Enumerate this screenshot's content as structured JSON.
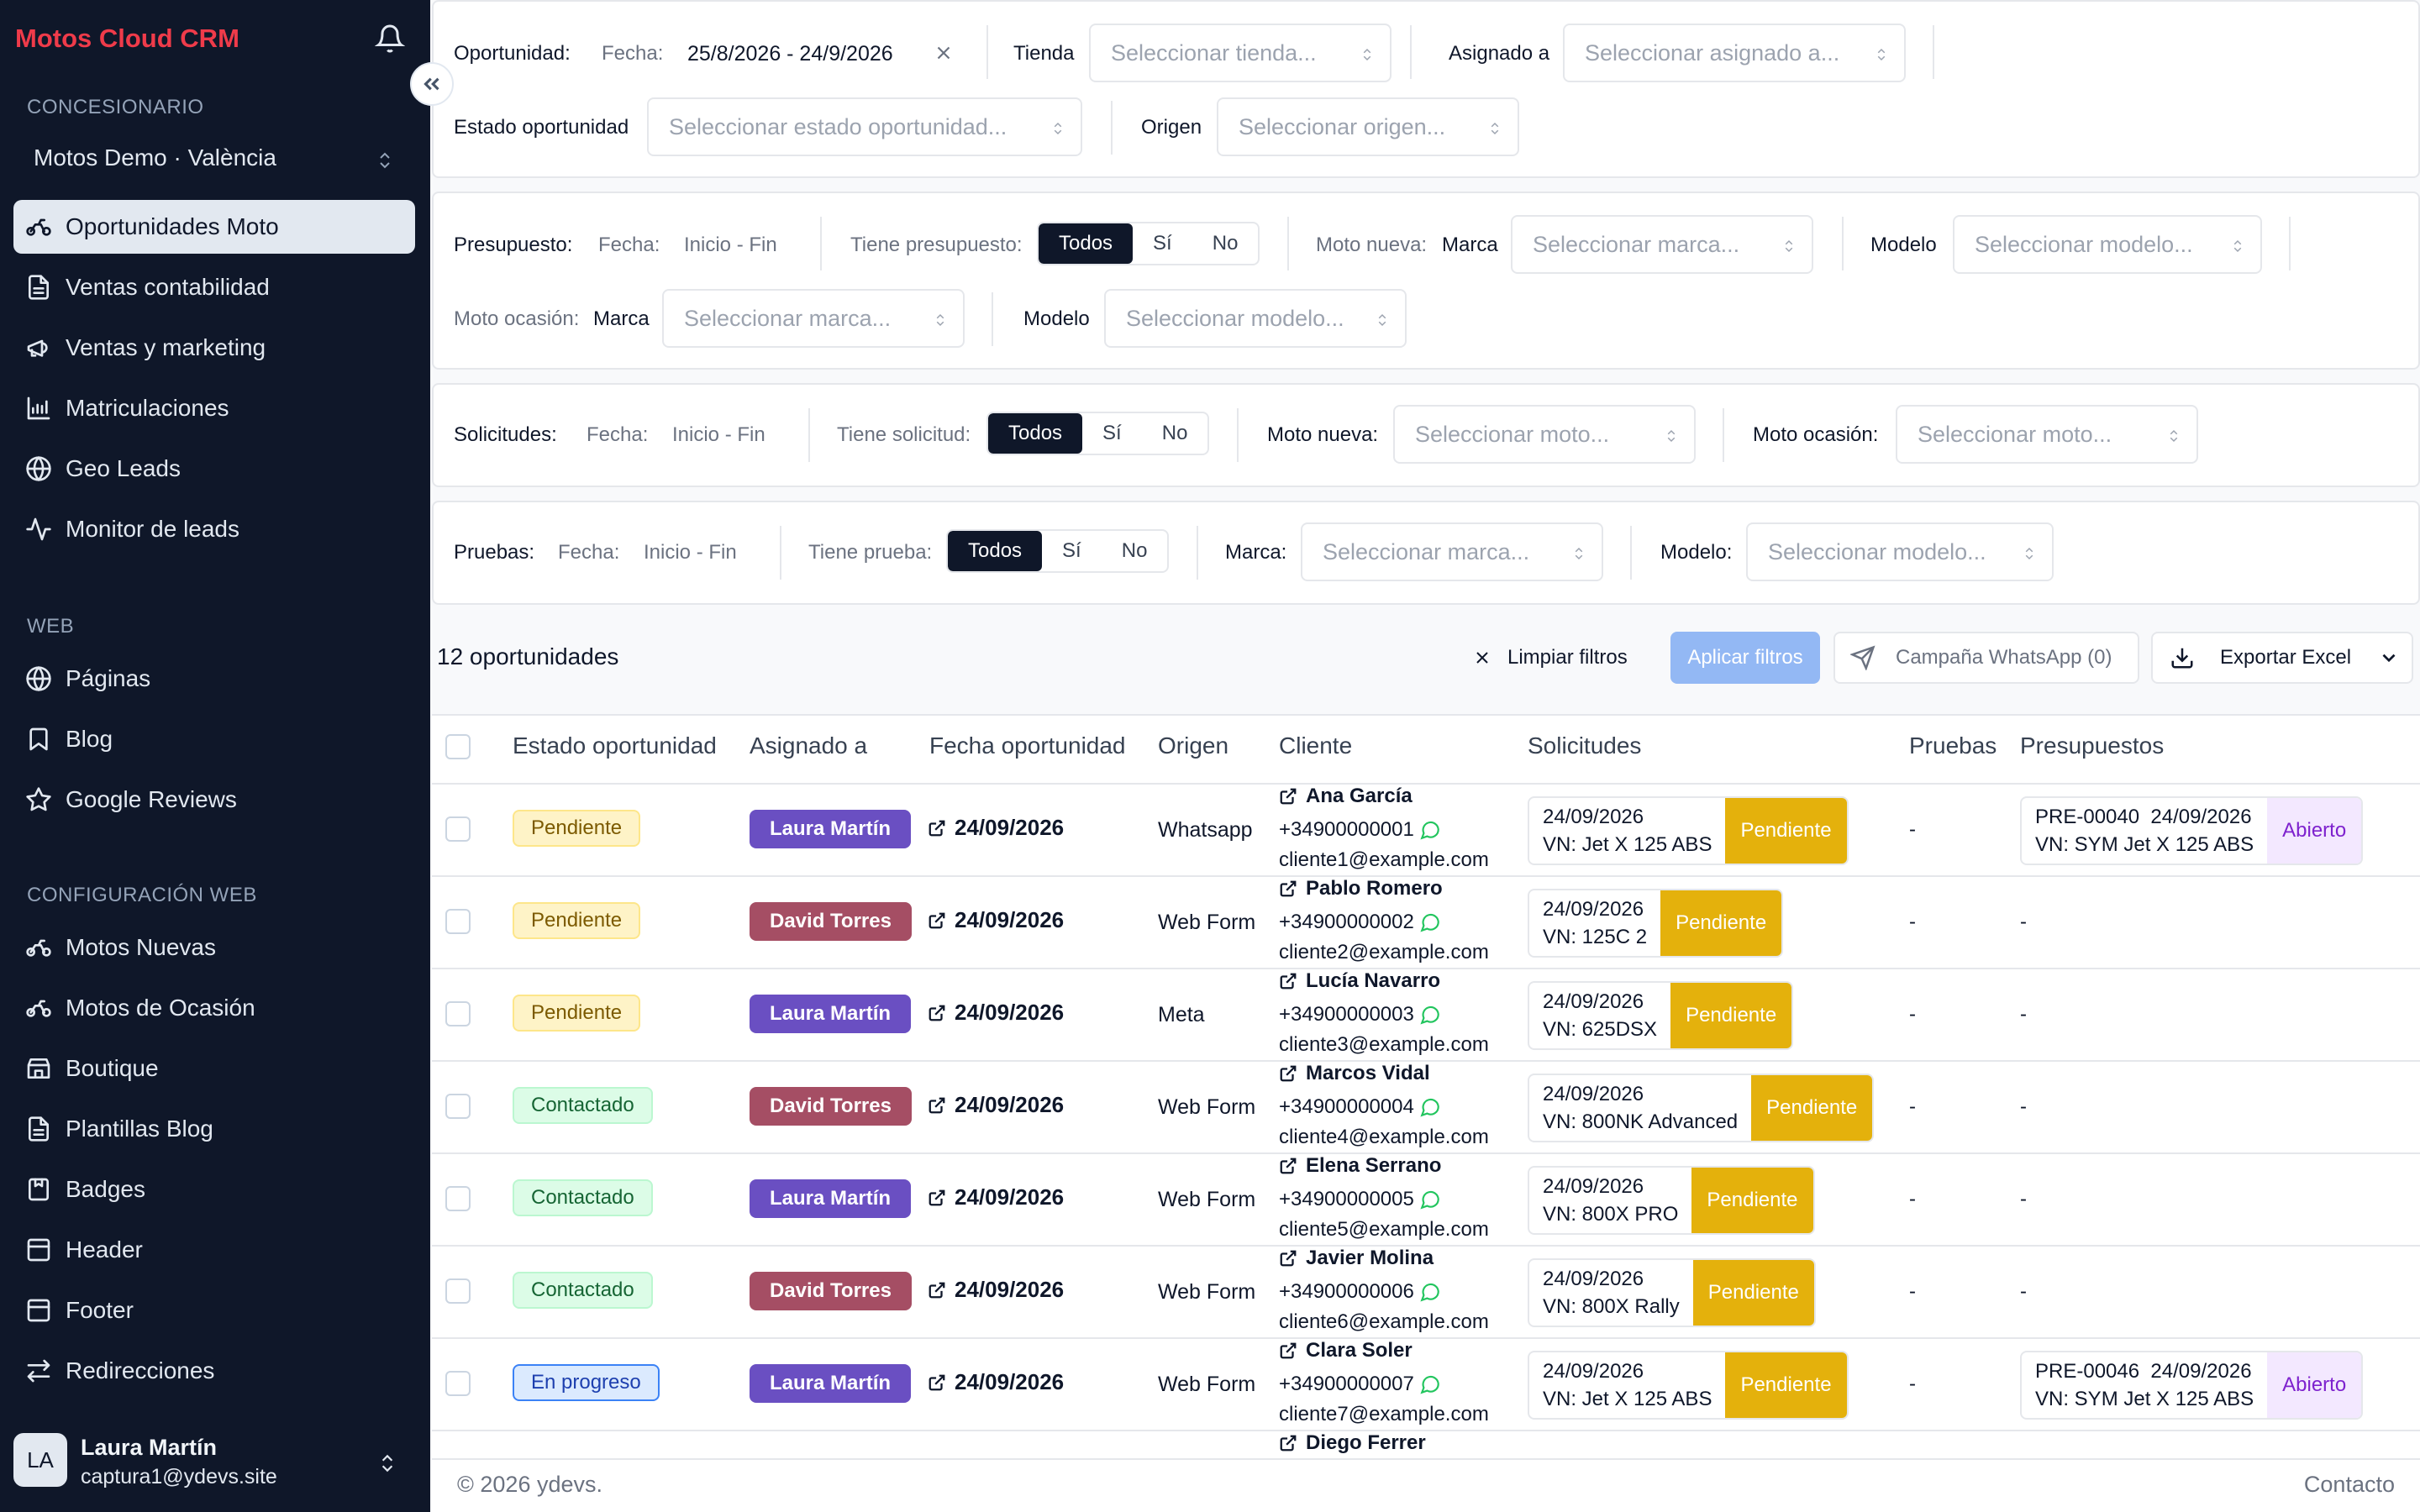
{
  "app": {
    "title": "Motos Cloud CRM"
  },
  "sidebar": {
    "section_dealer": "CONCESIONARIO",
    "dealer": "Motos Demo · València",
    "items_main": [
      {
        "label": "Oportunidades Moto",
        "icon": "motorbike-icon"
      },
      {
        "label": "Ventas contabilidad",
        "icon": "document-icon"
      },
      {
        "label": "Ventas y marketing",
        "icon": "megaphone-icon"
      },
      {
        "label": "Matriculaciones",
        "icon": "chart-icon"
      },
      {
        "label": "Geo Leads",
        "icon": "globe-icon"
      },
      {
        "label": "Monitor de leads",
        "icon": "activity-icon"
      }
    ],
    "section_web": "WEB",
    "items_web": [
      {
        "label": "Páginas",
        "icon": "globe-icon"
      },
      {
        "label": "Blog",
        "icon": "bookmark-icon"
      },
      {
        "label": "Google Reviews",
        "icon": "star-icon"
      }
    ],
    "section_config": "CONFIGURACIÓN WEB",
    "items_config": [
      {
        "label": "Motos Nuevas",
        "icon": "motorbike-icon"
      },
      {
        "label": "Motos de Ocasión",
        "icon": "motorbike-icon"
      },
      {
        "label": "Boutique",
        "icon": "store-icon"
      },
      {
        "label": "Plantillas Blog",
        "icon": "document-icon"
      },
      {
        "label": "Badges",
        "icon": "badge-icon"
      },
      {
        "label": "Header",
        "icon": "layout-icon"
      },
      {
        "label": "Footer",
        "icon": "layout-icon"
      },
      {
        "label": "Redirecciones",
        "icon": "arrows-icon"
      }
    ],
    "user": {
      "initials": "LA",
      "name": "Laura Martín",
      "email": "captura1@ydevs.site"
    }
  },
  "filters": {
    "opp": {
      "label": "Oportunidad:",
      "date_label": "Fecha:",
      "date_value": "25/8/2026 - 24/9/2026",
      "store_label": "Tienda",
      "store_ph": "Seleccionar tienda...",
      "assigned_label": "Asignado a",
      "assigned_ph": "Seleccionar asignado a...",
      "state_label": "Estado oportunidad",
      "state_ph": "Seleccionar estado oportunidad...",
      "origin_label": "Origen",
      "origin_ph": "Seleccionar origen..."
    },
    "budget": {
      "label": "Presupuesto:",
      "date_label": "Fecha:",
      "date_value": "Inicio - Fin",
      "has_label": "Tiene presupuesto:",
      "seg": [
        "Todos",
        "Sí",
        "No"
      ],
      "new_label": "Moto nueva:",
      "brand_label": "Marca",
      "brand_ph": "Seleccionar marca...",
      "model_label": "Modelo",
      "model_ph": "Seleccionar modelo...",
      "used_label": "Moto ocasión:",
      "brand2_label": "Marca",
      "brand2_ph": "Seleccionar marca...",
      "model2_label": "Modelo",
      "model2_ph": "Seleccionar modelo..."
    },
    "req": {
      "label": "Solicitudes:",
      "date_label": "Fecha:",
      "date_value": "Inicio - Fin",
      "has_label": "Tiene solicitud:",
      "seg": [
        "Todos",
        "Sí",
        "No"
      ],
      "new_label": "Moto nueva:",
      "new_ph": "Seleccionar moto...",
      "used_label": "Moto ocasión:",
      "used_ph": "Seleccionar moto..."
    },
    "test": {
      "label": "Pruebas:",
      "date_label": "Fecha:",
      "date_value": "Inicio - Fin",
      "has_label": "Tiene prueba:",
      "seg": [
        "Todos",
        "Sí",
        "No"
      ],
      "brand_label": "Marca:",
      "brand_ph": "Seleccionar marca...",
      "model_label": "Modelo:",
      "model_ph": "Seleccionar modelo..."
    }
  },
  "toolbar": {
    "count": "12 oportunidades",
    "clear": "Limpiar filtros",
    "apply": "Aplicar filtros",
    "whatsapp": "Campaña WhatsApp (0)",
    "export": "Exportar Excel"
  },
  "table": {
    "headers": [
      "Estado oportunidad",
      "Asignado a",
      "Fecha oportunidad",
      "Origen",
      "Cliente",
      "Solicitudes",
      "Pruebas",
      "Presupuestos"
    ],
    "rows": [
      {
        "state": "Pendiente",
        "agent": "Laura Martín",
        "date": "24/09/2026",
        "origin": "Whatsapp",
        "name": "Ana García",
        "phone": "+34900000001",
        "email": "cliente1@example.com",
        "sol_date": "24/09/2026",
        "sol_model": "VN: Jet X 125 ABS",
        "sol_status": "Pendiente",
        "tests": "-",
        "pre_code": "PRE-00040",
        "pre_date": "24/09/2026",
        "pre_model": "VN: SYM Jet X 125 ABS",
        "pre_status": "Abierto",
        "pre_none": ""
      },
      {
        "state": "Pendiente",
        "agent": "David Torres",
        "date": "24/09/2026",
        "origin": "Web Form",
        "name": "Pablo Romero",
        "phone": "+34900000002",
        "email": "cliente2@example.com",
        "sol_date": "24/09/2026",
        "sol_model": "VN: 125C 2",
        "sol_status": "Pendiente",
        "tests": "-",
        "pre_none": "-"
      },
      {
        "state": "Pendiente",
        "agent": "Laura Martín",
        "date": "24/09/2026",
        "origin": "Meta",
        "name": "Lucía Navarro",
        "phone": "+34900000003",
        "email": "cliente3@example.com",
        "sol_date": "24/09/2026",
        "sol_model": "VN: 625DSX",
        "sol_status": "Pendiente",
        "tests": "-",
        "pre_none": "-"
      },
      {
        "state": "Contactado",
        "agent": "David Torres",
        "date": "24/09/2026",
        "origin": "Web Form",
        "name": "Marcos Vidal",
        "phone": "+34900000004",
        "email": "cliente4@example.com",
        "sol_date": "24/09/2026",
        "sol_model": "VN: 800NK Advanced",
        "sol_status": "Pendiente",
        "tests": "-",
        "pre_none": "-"
      },
      {
        "state": "Contactado",
        "agent": "Laura Martín",
        "date": "24/09/2026",
        "origin": "Web Form",
        "name": "Elena Serrano",
        "phone": "+34900000005",
        "email": "cliente5@example.com",
        "sol_date": "24/09/2026",
        "sol_model": "VN: 800X PRO",
        "sol_status": "Pendiente",
        "tests": "-",
        "pre_none": "-"
      },
      {
        "state": "Contactado",
        "agent": "David Torres",
        "date": "24/09/2026",
        "origin": "Web Form",
        "name": "Javier Molina",
        "phone": "+34900000006",
        "email": "cliente6@example.com",
        "sol_date": "24/09/2026",
        "sol_model": "VN: 800X Rally",
        "sol_status": "Pendiente",
        "tests": "-",
        "pre_none": "-"
      },
      {
        "state": "En progreso",
        "agent": "Laura Martín",
        "date": "24/09/2026",
        "origin": "Web Form",
        "name": "Clara Soler",
        "phone": "+34900000007",
        "email": "cliente7@example.com",
        "sol_date": "24/09/2026",
        "sol_model": "VN: Jet X 125 ABS",
        "sol_status": "Pendiente",
        "tests": "-",
        "pre_code": "PRE-00046",
        "pre_date": "24/09/2026",
        "pre_model": "VN: SYM Jet X 125 ABS",
        "pre_status": "Abierto",
        "pre_none": ""
      },
      {
        "name": "Diego Ferrer"
      }
    ]
  },
  "footer": {
    "copyright": "© 2026 ydevs.",
    "contact": "Contacto"
  }
}
